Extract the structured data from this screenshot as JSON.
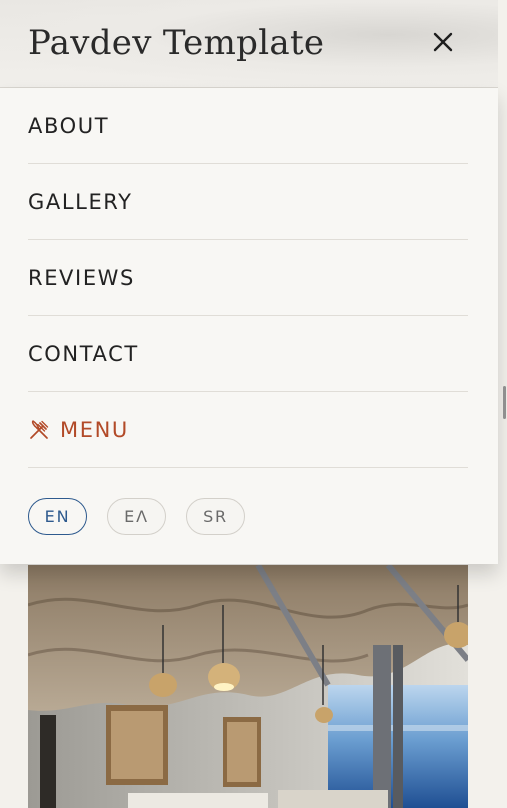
{
  "header": {
    "brand": "Pavdev Template",
    "close_icon": "close-icon"
  },
  "nav": {
    "items": [
      {
        "label": "ABOUT"
      },
      {
        "label": "GALLERY"
      },
      {
        "label": "REVIEWS"
      },
      {
        "label": "CONTACT"
      },
      {
        "label": "MENU",
        "icon": "utensils-icon",
        "accent": "#b24a28"
      }
    ]
  },
  "languages": {
    "options": [
      "EN",
      "ΕΛ",
      "SR"
    ],
    "selected": "EN",
    "selected_color": "#2e5a8e"
  },
  "photo": {
    "subject": "restaurant interior with sea view"
  }
}
